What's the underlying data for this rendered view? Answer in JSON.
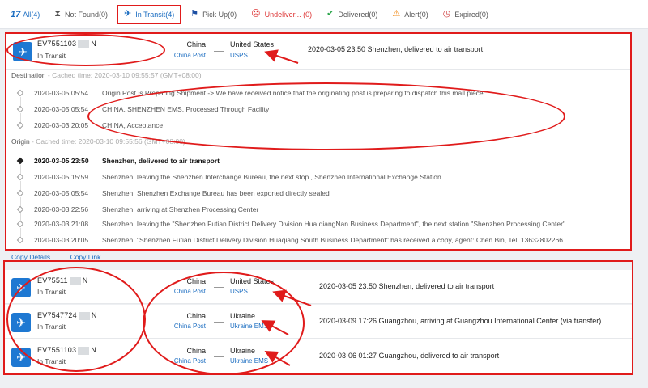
{
  "tabs": [
    {
      "logo": "17",
      "label": "All(4)"
    },
    {
      "icon": "hourglass-icon",
      "label": "Not Found(0)"
    },
    {
      "icon": "plane-icon",
      "label": "In Transit(4)"
    },
    {
      "icon": "flag-icon",
      "label": "Pick Up(0)"
    },
    {
      "icon": "frown-icon",
      "label": "Undeliver... (0)"
    },
    {
      "icon": "check-icon",
      "label": "Delivered(0)"
    },
    {
      "icon": "alert-icon",
      "label": "Alert(0)"
    },
    {
      "icon": "clock-icon",
      "label": "Expired(0)"
    }
  ],
  "expanded": {
    "number_prefix": "EV7551103",
    "number_suffix": "N",
    "status": "In Transit",
    "origin_country": "China",
    "origin_carrier": "China Post",
    "dest_country": "United States",
    "dest_carrier": "USPS",
    "latest": "2020-03-05 23:50  Shenzhen, delivered to air transport",
    "destination_label": "Destination",
    "destination_cache": " - Cached time: 2020-03-10 09:55:57 (GMT+08:00)",
    "destination_events": [
      {
        "time": "2020-03-05 05:54",
        "desc": "Origin Post is Preparing Shipment -> We have received notice that the originating post is preparing to dispatch this mail piece."
      },
      {
        "time": "2020-03-05 05:54",
        "desc": "CHINA, SHENZHEN EMS, Processed Through Facility"
      },
      {
        "time": "2020-03-03 20:05",
        "desc": "CHINA, Acceptance"
      }
    ],
    "origin_label": "Origin",
    "origin_cache": " - Cached time: 2020-03-10 09:55:56 (GMT+08:00)",
    "origin_events": [
      {
        "time": "2020-03-05 23:50",
        "desc": "Shenzhen, delivered to air transport"
      },
      {
        "time": "2020-03-05 15:59",
        "desc": "Shenzhen, leaving the Shenzhen Interchange Bureau, the next stop , Shenzhen International Exchange Station"
      },
      {
        "time": "2020-03-05 05:54",
        "desc": "Shenzhen, Shenzhen Exchange Bureau has been exported directly sealed"
      },
      {
        "time": "2020-03-03 22:56",
        "desc": "Shenzhen, arriving at Shenzhen Processing Center"
      },
      {
        "time": "2020-03-03 21:08",
        "desc": "Shenzhen, leaving the \"Shenzhen Futian District Delivery Division Hua qiangNan Business Department\", the next station \"Shenzhen Processing Center\""
      },
      {
        "time": "2020-03-03 20:05",
        "desc": "Shenzhen, \"Shenzhen Futian District Delivery Division Huaqiang South Business Department\" has received a copy, agent: Chen Bin, Tel: 13632802266"
      }
    ]
  },
  "actions": {
    "copy_details": "Copy Details",
    "copy_link": "Copy Link"
  },
  "packages": [
    {
      "number_prefix": "EV75511",
      "number_suffix": "N",
      "status": "In Transit",
      "origin_country": "China",
      "origin_carrier": "China Post",
      "dest_country": "United States",
      "dest_carrier": "USPS",
      "latest": "2020-03-05 23:50  Shenzhen, delivered to air transport"
    },
    {
      "number_prefix": "EV7547724",
      "number_suffix": "N",
      "status": "In Transit",
      "origin_country": "China",
      "origin_carrier": "China Post",
      "dest_country": "Ukraine",
      "dest_carrier": "Ukraine EMS",
      "latest": "2020-03-09 17:26  Guangzhou, arriving at Guangzhou International Center (via transfer)"
    },
    {
      "number_prefix": "EV7551103",
      "number_suffix": "N",
      "status": "In Transit",
      "origin_country": "China",
      "origin_carrier": "China Post",
      "dest_country": "Ukraine",
      "dest_carrier": "Ukraine EMS",
      "latest": "2020-03-06 01:27  Guangzhou, delivered to air transport"
    }
  ],
  "colors": {
    "accent": "#1b6dc1",
    "annotation_red": "#e01b1b",
    "icon_blue": "#1e78d2"
  }
}
